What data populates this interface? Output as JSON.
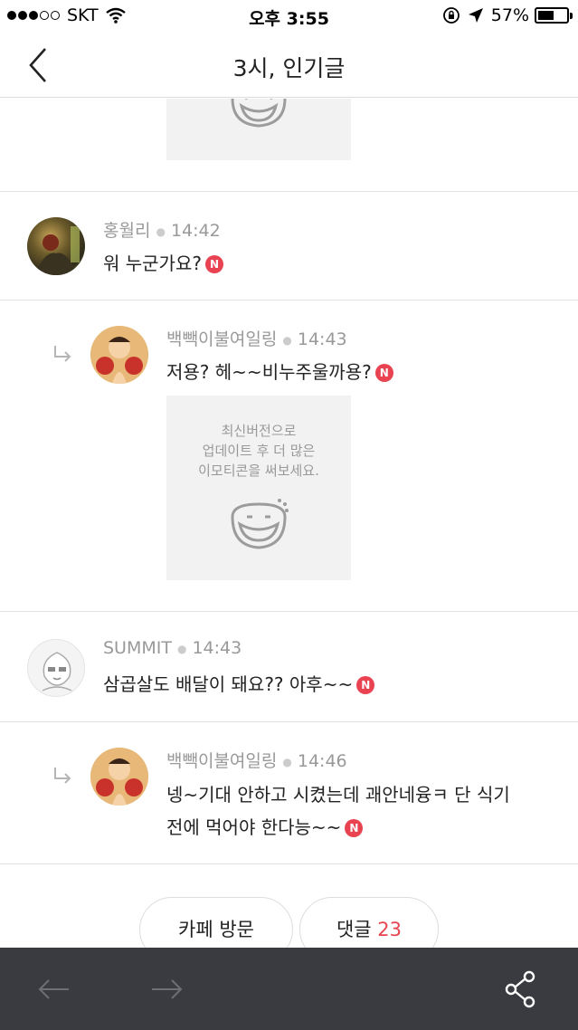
{
  "status_bar": {
    "carrier": "SKT",
    "time": "오후 3:55",
    "battery": "57%",
    "battery_level": 0.57
  },
  "header": {
    "title": "3시, 인기글"
  },
  "emoticon_placeholder": {
    "text": "최신버전으로\n업데이트 후 더 많은\n이모티콘을 써보세요."
  },
  "comments": [
    {
      "author": "홍월리",
      "time": "14:42",
      "text": "워 누군가요?",
      "badge": "N",
      "is_reply": false
    },
    {
      "author": "백빽이불여일링",
      "time": "14:43",
      "text": "저용? 헤~~비누주울까용?",
      "badge": "N",
      "is_reply": true
    },
    {
      "author": "SUMMIT",
      "time": "14:43",
      "text": "삼곱살도 배달이 돼요?? 아후~~",
      "badge": "N",
      "is_reply": false
    },
    {
      "author": "백빽이불여일링",
      "time": "14:46",
      "text_line1": "넹~기대 안하고 시켰는데 괘안네융ㅋ 단 식기",
      "text_line2": "전에 먹어야 한다능~~",
      "badge": "N",
      "is_reply": true
    }
  ],
  "actions": {
    "visit_cafe": "카페 방문",
    "comments_label": "댓글",
    "comments_count": "23"
  },
  "colors": {
    "accent": "#e94352",
    "toolbar_bg": "#3a3b40"
  },
  "icons": [
    "back-chevron-icon",
    "reply-arrow-icon",
    "new-badge-icon",
    "prev-arrow-icon",
    "next-arrow-icon",
    "share-icon"
  ]
}
